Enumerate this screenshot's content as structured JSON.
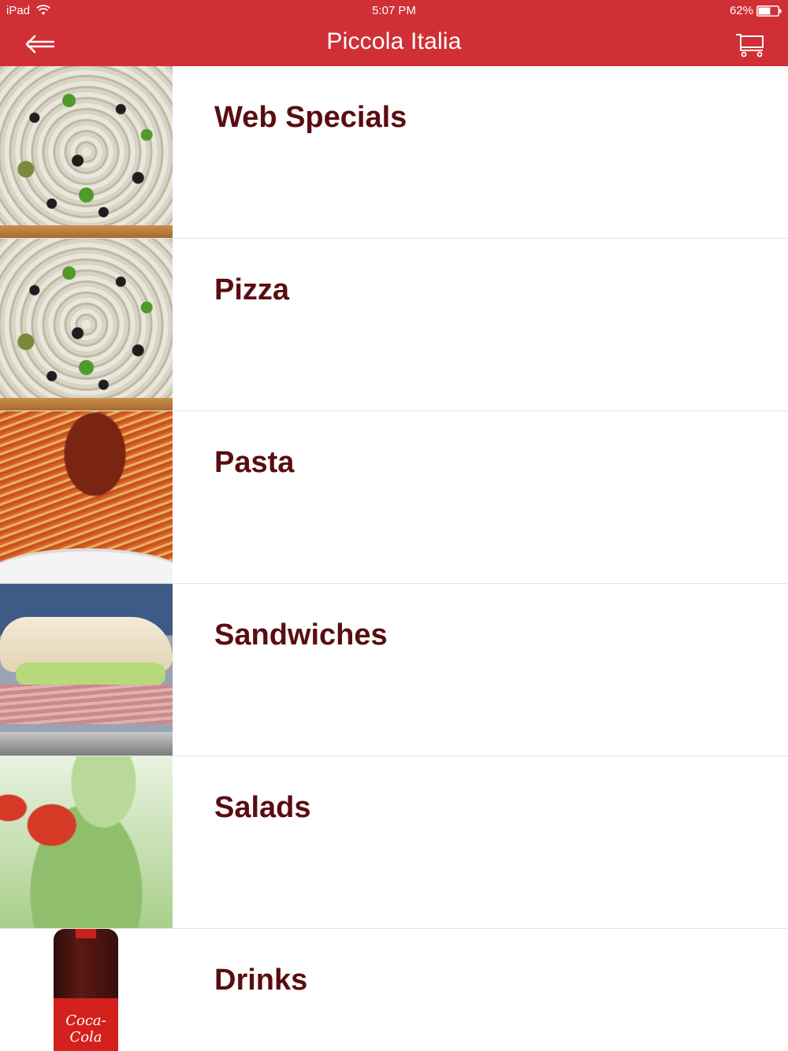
{
  "status_bar": {
    "device": "iPad",
    "time": "5:07 PM",
    "battery_percent": "62%",
    "battery_level": 0.62
  },
  "header": {
    "title": "Piccola Italia",
    "back_icon": "arrow-left-icon",
    "cart_icon": "shopping-cart-icon",
    "background_color": "#d02f36"
  },
  "categories": [
    {
      "label": "Web Specials",
      "image": "pizza-image"
    },
    {
      "label": "Pizza",
      "image": "pizza-image"
    },
    {
      "label": "Pasta",
      "image": "pasta-image"
    },
    {
      "label": "Sandwiches",
      "image": "sandwich-image"
    },
    {
      "label": "Salads",
      "image": "salad-image"
    },
    {
      "label": "Drinks",
      "image": "soda-bottle-image"
    }
  ],
  "drink_image_logo_text": "Coca-Cola",
  "colors": {
    "label_text": "#5a0d10",
    "divider": "#e4e4e4"
  }
}
